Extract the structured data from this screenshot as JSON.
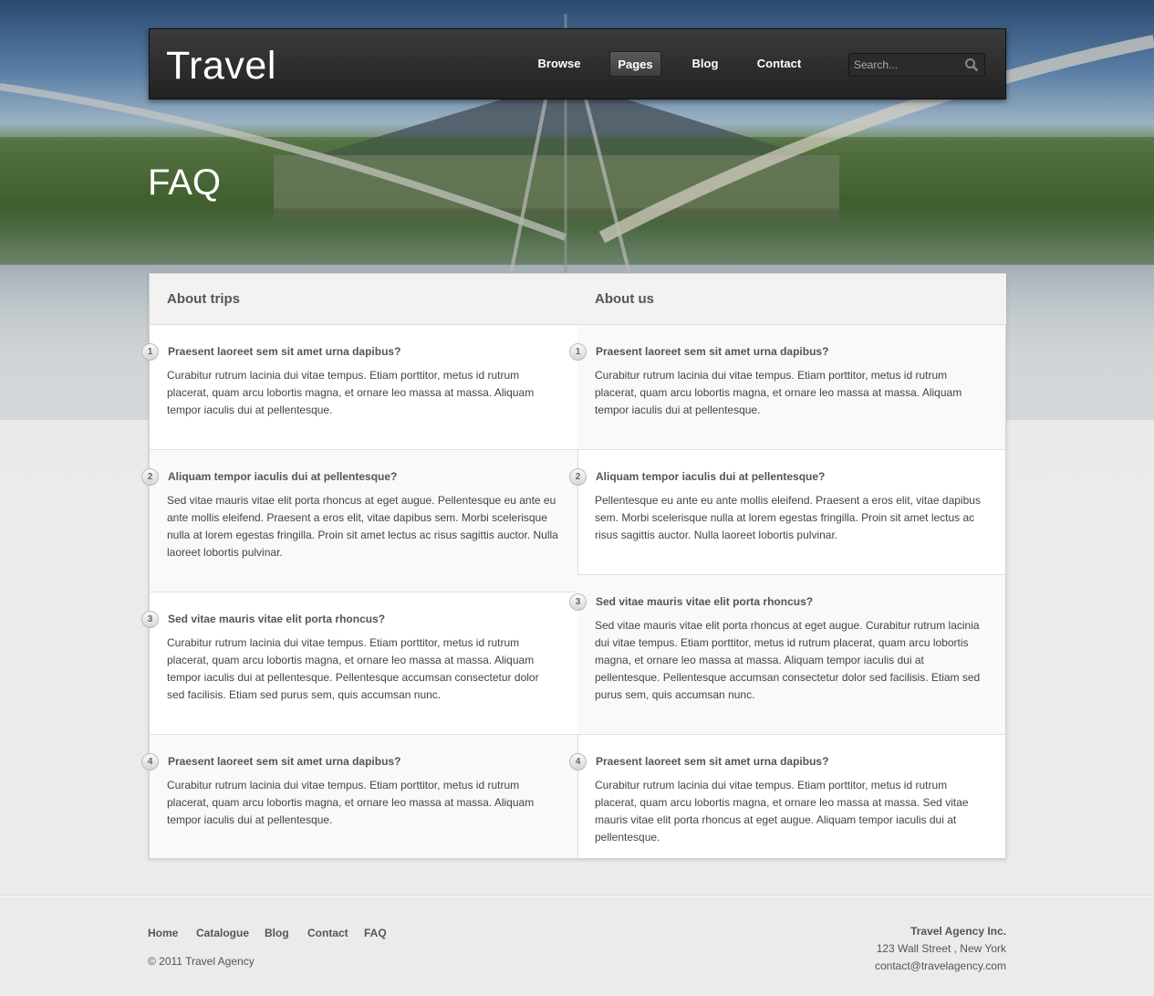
{
  "brand": {
    "logo": "Travel"
  },
  "nav": {
    "items": [
      {
        "label": "Browse"
      },
      {
        "label": "Pages"
      },
      {
        "label": "Blog"
      },
      {
        "label": "Contact"
      }
    ],
    "active": "Pages"
  },
  "search": {
    "placeholder": "Search..."
  },
  "page": {
    "title": "FAQ"
  },
  "faq": {
    "left": {
      "heading": "About trips",
      "items": [
        {
          "n": "1",
          "q": "Praesent laoreet sem sit amet urna dapibus?",
          "a": "Curabitur rutrum lacinia dui vitae tempus. Etiam porttitor, metus id rutrum placerat, quam arcu lobortis magna, et ornare leo massa at massa. Aliquam tempor iaculis dui at pellentesque."
        },
        {
          "n": "2",
          "q": "Aliquam tempor iaculis dui at pellentesque?",
          "a": "Sed vitae mauris vitae elit porta rhoncus at eget augue. Pellentesque eu ante eu ante mollis eleifend. Praesent a eros elit, vitae dapibus sem. Morbi scelerisque nulla at lorem egestas fringilla. Proin sit amet lectus ac risus sagittis auctor. Nulla laoreet lobortis pulvinar."
        },
        {
          "n": "3",
          "q": "Sed vitae mauris vitae elit porta rhoncus?",
          "a": "Curabitur rutrum lacinia dui vitae tempus. Etiam porttitor, metus id rutrum placerat, quam arcu lobortis magna, et ornare leo massa at massa. Aliquam tempor iaculis dui at pellentesque. Pellentesque accumsan consectetur dolor sed facilisis. Etiam sed purus sem, quis accumsan nunc."
        },
        {
          "n": "4",
          "q": "Praesent laoreet sem sit amet urna dapibus?",
          "a": "Curabitur rutrum lacinia dui vitae tempus. Etiam porttitor, metus id rutrum placerat, quam arcu lobortis magna, et ornare leo massa at massa. Aliquam tempor iaculis dui at pellentesque."
        }
      ]
    },
    "right": {
      "heading": "About us",
      "items": [
        {
          "n": "1",
          "q": "Praesent laoreet sem sit amet urna dapibus?",
          "a": "Curabitur rutrum lacinia dui vitae tempus. Etiam porttitor, metus id rutrum placerat, quam arcu lobortis magna, et ornare leo massa at massa. Aliquam tempor iaculis dui at pellentesque."
        },
        {
          "n": "2",
          "q": "Aliquam tempor iaculis dui at pellentesque?",
          "a": "Pellentesque eu ante eu ante mollis eleifend. Praesent a eros elit, vitae dapibus sem. Morbi scelerisque nulla at lorem egestas fringilla. Proin sit amet lectus ac risus sagittis auctor. Nulla laoreet lobortis pulvinar."
        },
        {
          "n": "3",
          "q": "Sed vitae mauris vitae elit porta rhoncus?",
          "a": "Sed vitae mauris vitae elit porta rhoncus at eget augue. Curabitur rutrum lacinia dui vitae tempus. Etiam porttitor, metus id rutrum placerat, quam arcu lobortis magna, et ornare leo massa at massa. Aliquam tempor iaculis dui at pellentesque. Pellentesque accumsan consectetur dolor sed facilisis. Etiam sed purus sem, quis accumsan nunc."
        },
        {
          "n": "4",
          "q": "Praesent laoreet sem sit amet urna dapibus?",
          "a": "Curabitur rutrum lacinia dui vitae tempus. Etiam porttitor, metus id rutrum placerat, quam arcu lobortis magna, et ornare leo massa at massa. Sed vitae mauris vitae elit porta rhoncus at eget augue. Aliquam tempor iaculis dui at pellentesque."
        }
      ]
    }
  },
  "footer": {
    "links": [
      {
        "label": "Home"
      },
      {
        "label": "Catalogue"
      },
      {
        "label": "Blog"
      },
      {
        "label": "Contact"
      },
      {
        "label": "FAQ"
      }
    ],
    "copyright": "© 2011 Travel Agency",
    "company": "Travel Agency Inc.",
    "address": "123 Wall Street , New York",
    "email": "contact@travelagency.com"
  },
  "colors": {
    "header_bg": "#2b2b2b",
    "page_bg": "#ebebea",
    "accent_text": "#555555"
  }
}
